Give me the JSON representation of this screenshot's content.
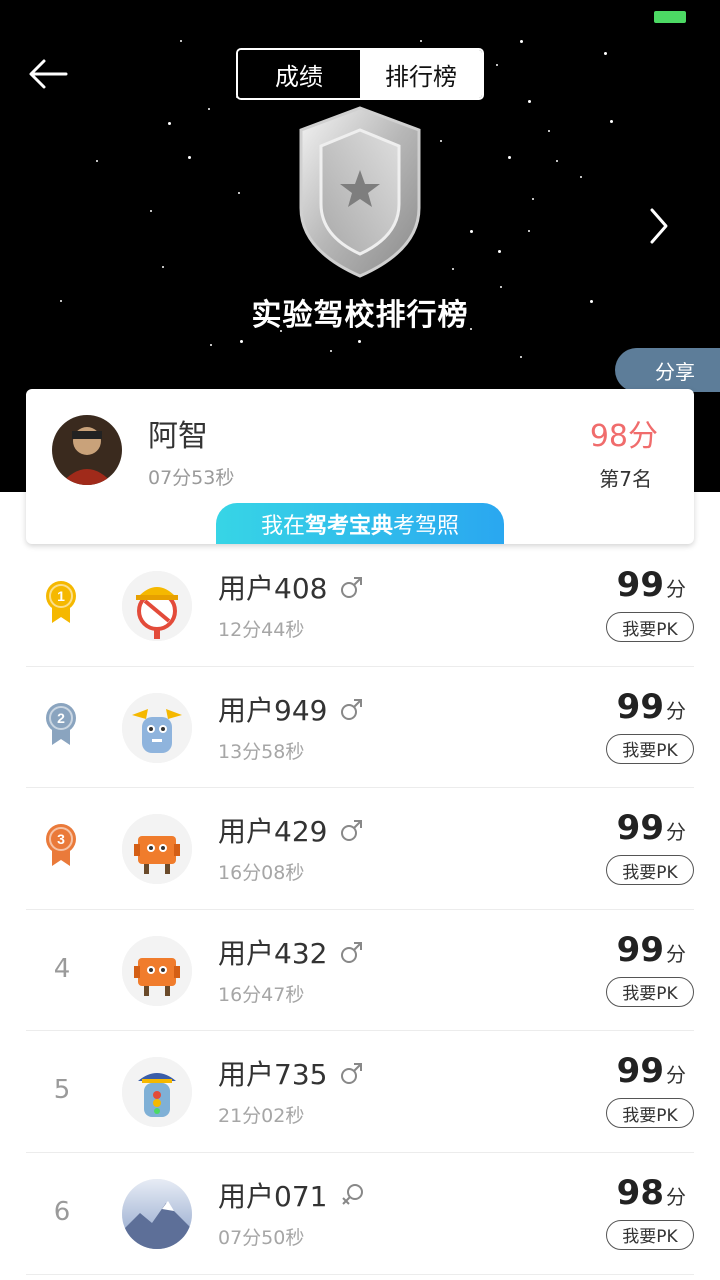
{
  "status_bar": {
    "battery_color": "#4cd964"
  },
  "nav": {
    "back_icon": "arrow-left-icon",
    "tabs": [
      {
        "label": "成绩",
        "active": true
      },
      {
        "label": "排行榜",
        "active": false
      }
    ],
    "next_icon": "chevron-right-icon"
  },
  "hero": {
    "title": "实验驾校排行榜",
    "badge_icon": "shield-star-icon",
    "share_label": "分享"
  },
  "my_result": {
    "name": "阿智",
    "time": "07分53秒",
    "score": "98分",
    "rank": "第7名",
    "promo_prefix": "我在",
    "promo_highlight": "驾考宝典",
    "promo_suffix": "考驾照",
    "score_color": "#f06c6c"
  },
  "leaderboard": [
    {
      "rank": "1",
      "medal": "gold",
      "name": "用户408",
      "gender": "male",
      "time": "12分44秒",
      "score": "99",
      "unit": "分",
      "pk_label": "我要PK",
      "avatar": "helmet-mascot"
    },
    {
      "rank": "2",
      "medal": "silver",
      "name": "用户949",
      "gender": "male",
      "time": "13分58秒",
      "score": "99",
      "unit": "分",
      "pk_label": "我要PK",
      "avatar": "blue-mascot"
    },
    {
      "rank": "3",
      "medal": "bronze",
      "name": "用户429",
      "gender": "male",
      "time": "16分08秒",
      "score": "99",
      "unit": "分",
      "pk_label": "我要PK",
      "avatar": "orange-mascot"
    },
    {
      "rank": "4",
      "medal": null,
      "name": "用户432",
      "gender": "male",
      "time": "16分47秒",
      "score": "99",
      "unit": "分",
      "pk_label": "我要PK",
      "avatar": "orange-mascot"
    },
    {
      "rank": "5",
      "medal": null,
      "name": "用户735",
      "gender": "male",
      "time": "21分02秒",
      "score": "99",
      "unit": "分",
      "pk_label": "我要PK",
      "avatar": "police-mascot"
    },
    {
      "rank": "6",
      "medal": null,
      "name": "用户071",
      "gender": "female",
      "time": "07分50秒",
      "score": "98",
      "unit": "分",
      "pk_label": "我要PK",
      "avatar": "landscape-photo"
    }
  ],
  "colors": {
    "gold": "#f5b800",
    "silver": "#8aa4bf",
    "bronze": "#ea7a3a",
    "accent": "#2aa7f0"
  }
}
